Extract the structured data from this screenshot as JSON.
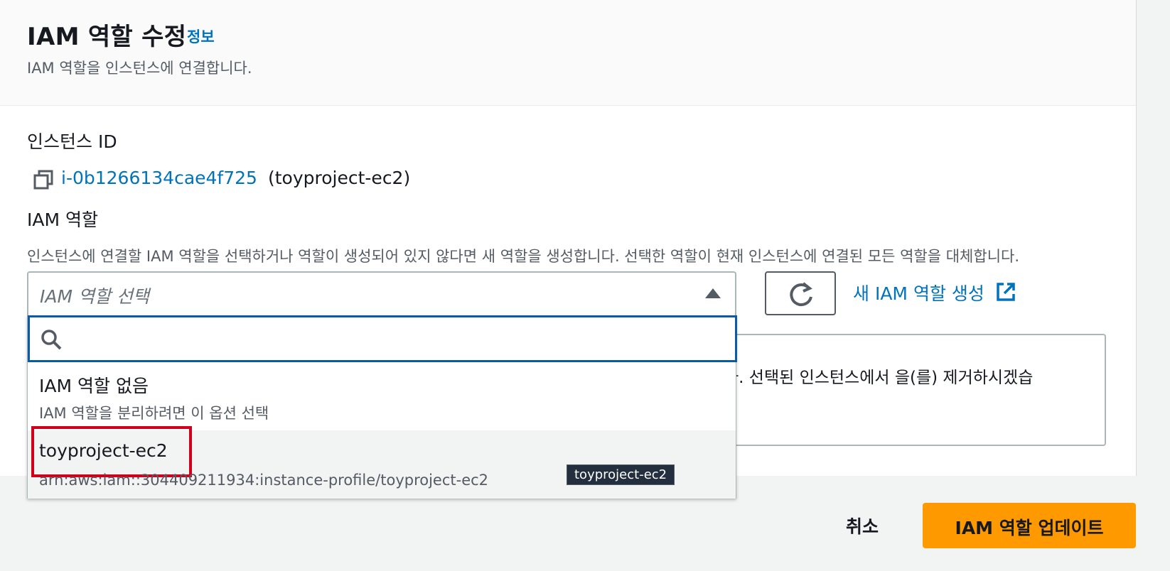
{
  "header": {
    "title": "IAM 역할 수정",
    "info_link": "정보",
    "subtitle": "IAM 역할을 인스턴스에 연결합니다."
  },
  "instance": {
    "label": "인스턴스 ID",
    "id": "i-0b1266134cae4f725",
    "name": "(toyproject-ec2)"
  },
  "iam_role": {
    "label": "IAM 역할",
    "description": "인스턴스에 연결할 IAM 역할을 선택하거나 역할이 생성되어 있지 않다면 새 역할을 생성합니다. 선택한 역할이 현재 인스턴스에 연결된 모든 역할을 대체합니다.",
    "select_placeholder": "IAM 역할 선택",
    "new_role_link": "새 IAM 역할 생성",
    "search_value": "",
    "options": [
      {
        "title": "IAM 역할 없음",
        "subtitle": "IAM 역할을 분리하려면 이 옵션 선택"
      },
      {
        "title": "toyproject-ec2",
        "subtitle": "arn:aws:iam::304409211934:instance-profile/toyproject-ec2"
      }
    ],
    "tooltip": "toyproject-ec2"
  },
  "alert": {
    "text": "다. 선택된 인스턴스에서 을(를) 제거하시겠습"
  },
  "footer": {
    "cancel_label": "취소",
    "update_label": "IAM 역할 업데이트"
  },
  "colors": {
    "link": "#0073bb",
    "primary": "#ff9900",
    "highlight": "#d0021b",
    "focus": "#0a5aa5"
  }
}
